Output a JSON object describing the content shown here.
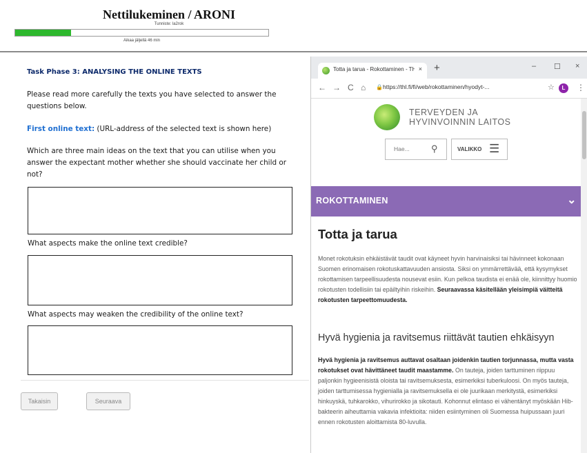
{
  "header": {
    "title": "Nettilukeminen / ARONI",
    "user_id": "Tunniste: la2rok",
    "progress_fraction": 0.22,
    "time_left": "Aikaa jäljellä 46 min"
  },
  "task": {
    "phase_title": "Task Phase 3: ANALYSING THE ONLINE TEXTS",
    "intro": "Please read more carefully the texts you have selected to answer the questions below.",
    "first_text_label": "First online text:",
    "first_text_note": " (URL-address of the selected text is shown here)",
    "question_1": "Which are three main ideas on the text that you can utilise when you answer the expectant mother whether she should vaccinate her child or not?",
    "question_2": "What aspects make the online text credible?",
    "question_3": "What aspects may weaken the credibility of the online text?"
  },
  "buttons": {
    "back": "Takaisin",
    "next": "Seuraava"
  },
  "browser": {
    "tab_title": "Totta ja tarua - Rokottaminen - TH",
    "tab_close": "×",
    "new_tab": "+",
    "minimize": "–",
    "maximize": "☐",
    "close": "×",
    "back_icon": "←",
    "forward_icon": "→",
    "reload_icon": "C",
    "home_icon": "⌂",
    "url": "https://thl.fi/fi/web/rokottaminen/hyodyt-...",
    "avatar_letter": "L",
    "star_icon": "☆",
    "menu_icon": "⋮"
  },
  "site": {
    "logo_line1": "TERVEYDEN JA",
    "logo_line2": "HYVINVOINNIN LAITOS",
    "search_placeholder": "Hae...",
    "menu_label": "VALIKKO",
    "section_label": "ROKOTTAMINEN",
    "article_title": "Totta ja tarua",
    "para1_normal": "Monet rokotuksin ehkäistävät taudit ovat käyneet hyvin harvinaisiksi tai hävinneet kokonaan Suomen erinomaisen rokotuskattavuuden ansiosta. Siksi on ymmärrettävää, että kysymykset rokottamisen tarpeellisuudesta nousevat esiin. Kun pelkoa taudista ei enää ole, kiinnittyy huomio rokotusten todellisiin tai epäiltyihin riskeihin.",
    "para1_bold": "Seuraavassa käsitellään yleisimpiä väitteitä rokotusten tarpeettomuudesta.",
    "subheading": "Hyvä hygienia ja ravitsemus riittävät tautien ehkäisyyn",
    "para2_bold": "Hyvä hygienia ja ravitsemus auttavat osaltaan joidenkin tautien torjunnassa, mutta vasta rokotukset ovat hävittäneet taudit maastamme.",
    "para2_normal": "On tauteja, joiden tarttuminen riippuu paljonkin hygieenisistä oloista tai ravitsemuksesta, esimerkiksi tuberkuloosi. On myös tauteja, joiden tarttumisessa hygienialla ja ravitsemuksella ei ole juurikaan merkitystä, esimerkiksi hinkuyskä, tuhkarokko, vihurirokko ja sikotauti. Kohonnut elintaso ei vähentänyt myöskään Hib-bakteerin aiheuttamia vakavia infektioita: niiden esiintyminen oli Suomessa huipussaan juuri ennen rokotusten aloittamista 80-luvulla."
  }
}
